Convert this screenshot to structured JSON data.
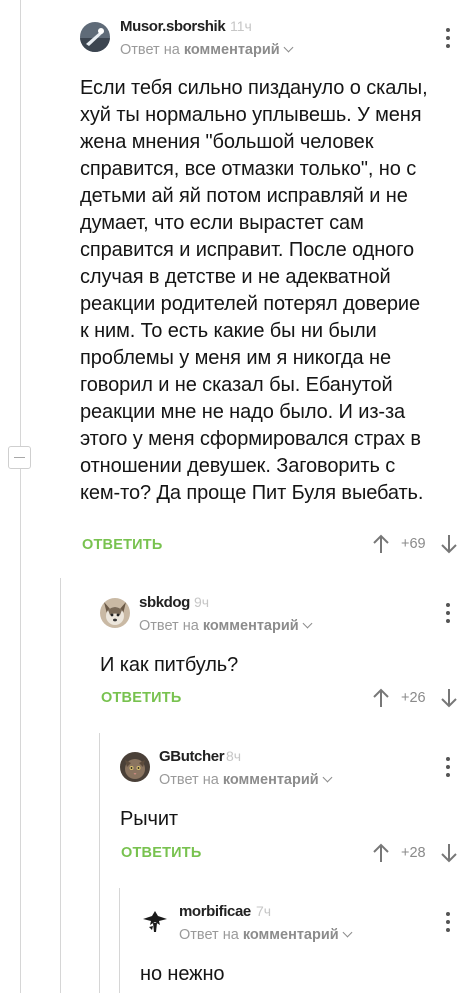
{
  "comments": [
    {
      "username": "Musor.sborshik",
      "time": "11ч",
      "reply_prefix": "Ответ на",
      "reply_target": "комментарий",
      "text": "Если тебя сильно пиздануло о скалы, хуй ты нормально уплывешь. У меня жена мнения \"большой человек справится, все отмазки только\", но с детьми ай яй потом исправляй и не думает, что если вырастет сам справится и исправит. После одного случая в детстве и не адекватной реакции родителей потерял доверие к ним. То есть какие бы ни были проблемы у меня им я никогда не говорил и не сказал бы. Ебанутой реакции мне не надо было. И из-за этого у меня сформировался страх в отношении девушек. Заговорить с кем-то? Да проще Пит Буля выебать.",
      "reply_button": "ОТВЕТИТЬ",
      "rating": "+69"
    },
    {
      "username": "sbkdog",
      "time": "9ч",
      "reply_prefix": "Ответ на",
      "reply_target": "комментарий",
      "text": "И как питбуль?",
      "reply_button": "ОТВЕТИТЬ",
      "rating": "+26"
    },
    {
      "username": "GButcher",
      "time": "8ч",
      "reply_prefix": "Ответ на",
      "reply_target": "комментарий",
      "text": "Рычит",
      "reply_button": "ОТВЕТИТЬ",
      "rating": "+28"
    },
    {
      "username": "morbificae",
      "time": "7ч",
      "reply_prefix": "Ответ на",
      "reply_target": "комментарий",
      "text": "но нежно"
    }
  ],
  "colors": {
    "reply_button": "#78c24f",
    "thread_line": "#d6d6d6",
    "meta": "#9a9a9a"
  },
  "icons": [
    "avatar",
    "chevron-down-icon",
    "more-vertical-icon",
    "arrow-up-icon",
    "arrow-down-icon",
    "collapse-minus-icon"
  ]
}
